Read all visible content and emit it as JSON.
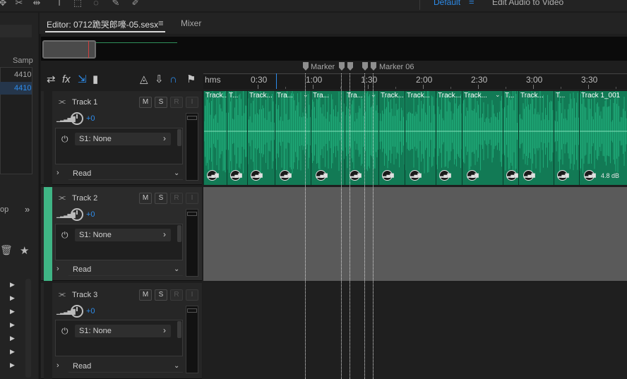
{
  "workspace": {
    "default_label": "Default",
    "menu_glyph": "=",
    "edit_to_video_label": "Edit Audio to Video"
  },
  "left_panel": {
    "column_header": "Samp",
    "row_values": [
      "4410",
      "4410"
    ],
    "section_label": "op",
    "expand_glyph": "»"
  },
  "tabs": {
    "editor_label": "Editor: 0712跪哭郎嚎-05.sesx",
    "editor_menu_glyph": "≡",
    "mixer_label": "Mixer"
  },
  "markers": [
    {
      "label": "Marker"
    },
    {
      "label": ""
    },
    {
      "label": ""
    },
    {
      "label": ""
    },
    {
      "label": "Marker 06"
    }
  ],
  "ruler": {
    "unit_label": "hms",
    "ticks": [
      "0:30",
      "1:00",
      "1:30",
      "2:00",
      "2:30",
      "3:00",
      "3:30"
    ]
  },
  "tracks": [
    {
      "name": "Track 1",
      "volume": "+0",
      "send": "S1: None",
      "automation": "Read",
      "accent": "#1e1e1e"
    },
    {
      "name": "Track 2",
      "volume": "+0",
      "send": "S1: None",
      "automation": "Read",
      "accent": "#3fb585"
    },
    {
      "name": "Track 3",
      "volume": "+0",
      "send": "S1: None",
      "automation": "Read",
      "accent": "#1e1e1e"
    }
  ],
  "track_buttons": {
    "mute": "M",
    "solo": "S",
    "arm": "R",
    "input": "I"
  },
  "clips": [
    {
      "title": "Track..."
    },
    {
      "title": "T..."
    },
    {
      "title": "Track..."
    },
    {
      "title": "Tra..."
    },
    {
      "title": "Tra..."
    },
    {
      "title": "Tra..."
    },
    {
      "title": "Track..."
    },
    {
      "title": "Track..."
    },
    {
      "title": "Track..."
    },
    {
      "title": "Track..."
    },
    {
      "title": "T..."
    },
    {
      "title": "Track..."
    },
    {
      "title": "T..."
    },
    {
      "title": "Track 1_001"
    }
  ],
  "clip_gain_label": "4.8 dB",
  "colors": {
    "accent_blue": "#2d8ceb",
    "waveform_green": "#1faa78",
    "track_selected": "#3fb585"
  }
}
